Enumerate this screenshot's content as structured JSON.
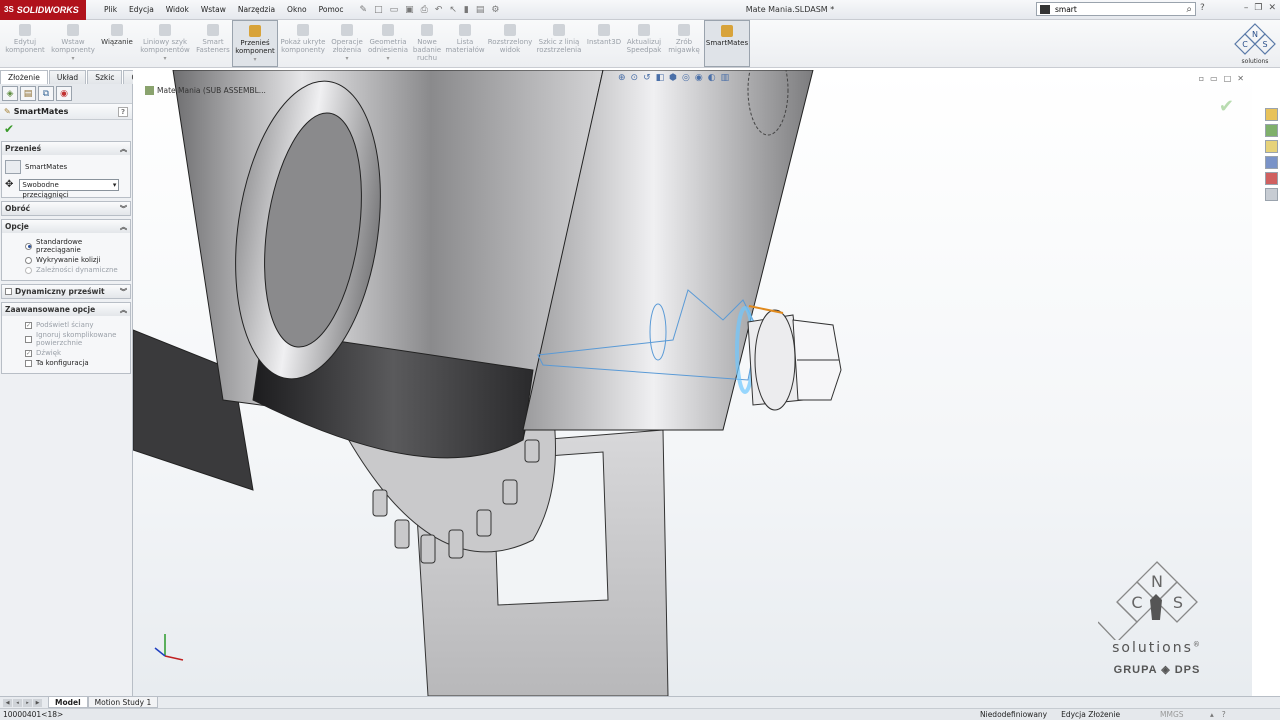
{
  "app": {
    "brand": "SOLIDWORKS",
    "brand_prefix": "3S",
    "doc_title": "Mate Mania.SLDASM *"
  },
  "menu": [
    "Plik",
    "Edycja",
    "Widok",
    "Wstaw",
    "Narzędzia",
    "Okno",
    "Pomoc"
  ],
  "search": {
    "value": "smart"
  },
  "ribbon": {
    "buttons": [
      {
        "label": "Edytuj komponent"
      },
      {
        "label": "Wstaw komponenty"
      },
      {
        "label": "Wiązanie"
      },
      {
        "label": "Liniowy szyk komponentów"
      },
      {
        "label": "Smart Fasteners"
      },
      {
        "label": "Przenieś komponent"
      },
      {
        "label": "Pokaż ukryte komponenty"
      },
      {
        "label": "Operacje złożenia"
      },
      {
        "label": "Geometria odniesienia"
      },
      {
        "label": "Nowe badanie ruchu"
      },
      {
        "label": "Lista materiałów"
      },
      {
        "label": "Rozstrzelony widok"
      },
      {
        "label": "Szkic z linią rozstrzelenia"
      },
      {
        "label": "Instant3D"
      },
      {
        "label": "Aktualizuj Speedpak"
      },
      {
        "label": "Zrób migawkę"
      },
      {
        "label": "SmartMates"
      }
    ]
  },
  "cm_tabs": [
    "Złożenie",
    "Układ",
    "Szkic",
    "Oceń"
  ],
  "property_manager": {
    "title": "SmartMates",
    "move_group": {
      "title": "Przenieś",
      "field_label": "SmartMates",
      "drag_mode": "Swobodne przeciągnięci"
    },
    "rotate_group": {
      "title": "Obróć"
    },
    "options_group": {
      "title": "Opcje",
      "standard_drag": "Standardowe przeciąganie",
      "collision": "Wykrywanie kolizji",
      "dynamic": "Zależności dynamiczne"
    },
    "dynamic_clearance": {
      "title": "Dynamiczny prześwit"
    },
    "advanced": {
      "title": "Zaawansowane opcje",
      "highlight": "Podświetl ściany",
      "ignore_complex": "Ignoruj skomplikowane powierzchnie",
      "sound": "Dźwięk",
      "this_config": "Ta konfiguracja"
    }
  },
  "viewport": {
    "crumb": "Mate Mania (SUB ASSEMBL..."
  },
  "bottom_tabs": [
    "Model",
    "Motion Study 1"
  ],
  "status": {
    "left": "10000401<18>",
    "state1": "Niedodefiniowany",
    "state2": "Edycja Złożenie",
    "units": "MMGS"
  },
  "branding": {
    "solutions": "solutions",
    "group": "GRUPA",
    "dps": "DPS",
    "reg": "®"
  },
  "colors": {
    "brand_red": "#b0121b",
    "ok_green": "#3a9a2a",
    "sketch_blue": "#5a9ad6",
    "edge_orange": "#e08a1e"
  }
}
